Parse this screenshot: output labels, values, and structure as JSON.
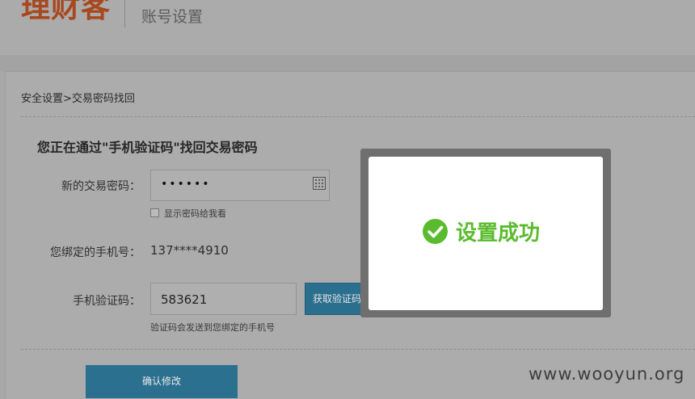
{
  "header": {
    "logo_text": "理财客",
    "page_title": "账号设置"
  },
  "breadcrumb": {
    "text": "安全设置>交易密码找回"
  },
  "form": {
    "heading": "您正在通过\"手机验证码\"找回交易密码",
    "new_password_label": "新的交易密码：",
    "new_password_value": "••••••",
    "show_password_label": "显示密码给我看",
    "phone_label": "您绑定的手机号：",
    "phone_value": "137****4910",
    "code_label": "手机验证码：",
    "code_value": "583621",
    "get_code_button": "获取验证码",
    "code_hint": "验证码会发送到您绑定的手机号",
    "confirm_button": "确认修改"
  },
  "modal": {
    "message": "设置成功",
    "icon": "check-circle-icon"
  },
  "watermark": {
    "text": "www.wooyun.org"
  },
  "colors": {
    "accent_blue": "#2c7090",
    "success_green": "#5bbb2e",
    "logo_orange": "#a7481f"
  }
}
